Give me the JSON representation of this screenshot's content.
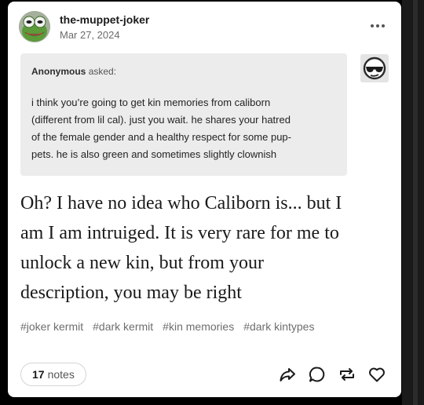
{
  "post": {
    "username": "the-muppet-joker",
    "date": "Mar 27, 2024",
    "more_icon": "more-horizontal-icon"
  },
  "ask": {
    "asker_name": "Anonymous",
    "asked_label": "asked:",
    "question_lines": [
      "i think you’re going to get kin memories from caliborn",
      "(different from lil cal). just you wait. he shares your hatred",
      "of the female gender and a healthy respect for some pup-",
      "pets. he is also green and sometimes slightly clownish"
    ]
  },
  "answer": {
    "lines": [
      "Oh? I have no idea who Caliborn is... but I",
      "am I am intruiged. It is very rare for me to",
      "unlock a new kin, but from your",
      "description, you may be right"
    ]
  },
  "tags": [
    "#joker kermit",
    "#dark kermit",
    "#kin memories",
    "#dark kintypes"
  ],
  "footer": {
    "notes_count": "17",
    "notes_label": "notes",
    "icons": [
      "share-icon",
      "reply-icon",
      "reblog-icon",
      "like-icon"
    ]
  },
  "colors": {
    "background": "#000000",
    "card": "#ffffff",
    "ask_bubble": "#ececec",
    "text": "#1a1a1a",
    "muted": "#6e6e6e"
  }
}
